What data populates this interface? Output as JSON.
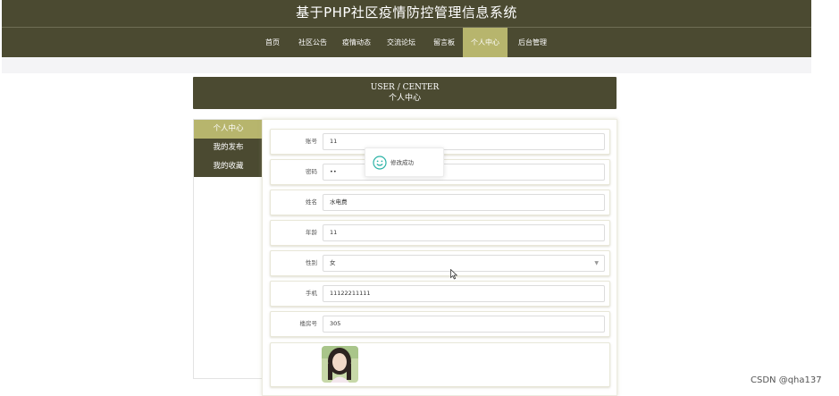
{
  "site": {
    "title": "基于PHP社区疫情防控管理信息系统"
  },
  "nav": {
    "items": [
      {
        "label": "首页"
      },
      {
        "label": "社区公告"
      },
      {
        "label": "疫情动态"
      },
      {
        "label": "交流论坛"
      },
      {
        "label": "留言板"
      },
      {
        "label": "个人中心"
      },
      {
        "label": "后台管理"
      }
    ],
    "active_index": 5
  },
  "header": {
    "title_en": "USER / CENTER",
    "title_cn": "个人中心"
  },
  "sidebar": {
    "items": [
      {
        "label": "个人中心"
      },
      {
        "label": "我的发布"
      },
      {
        "label": "我的收藏"
      }
    ],
    "active_index": 0
  },
  "form": {
    "fields": [
      {
        "label": "账号",
        "value": "11"
      },
      {
        "label": "密码",
        "value": "••"
      },
      {
        "label": "姓名",
        "value": "水电费"
      },
      {
        "label": "年龄",
        "value": "11"
      },
      {
        "label": "性别",
        "value": "女"
      },
      {
        "label": "手机",
        "value": "11122211111"
      },
      {
        "label": "楼房号",
        "value": "305"
      }
    ]
  },
  "toast": {
    "message": "修改成功",
    "icon": "smile-icon"
  },
  "watermark": "CSDN @qha137",
  "colors": {
    "nav_bg": "#4b4a31",
    "accent": "#b7b56d",
    "toast_icon": "#2bb3a6"
  }
}
